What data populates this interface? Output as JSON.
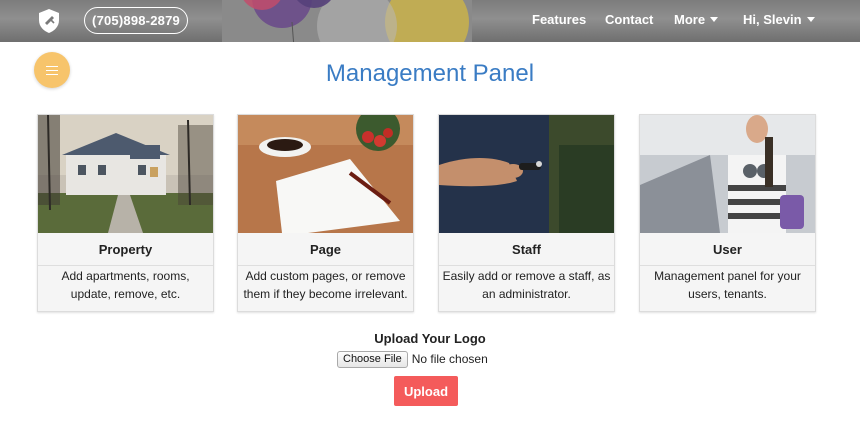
{
  "header": {
    "logo": "shield-logo",
    "phone": "(705)898-2879",
    "nav": {
      "features": "Features",
      "contact": "Contact",
      "more": "More",
      "user": "Hi, Slevin"
    }
  },
  "main": {
    "menu_icon": "hamburger-icon",
    "title": "Management Panel",
    "cards": [
      {
        "title": "Property",
        "description": "Add apartments, rooms, update, remove, etc."
      },
      {
        "title": "Page",
        "description": "Add custom pages, or remove them if they become irrelevant."
      },
      {
        "title": "Staff",
        "description": "Easily add or remove a staff, as an administrator."
      },
      {
        "title": "User",
        "description": "Management panel for your users, tenants."
      }
    ],
    "upload": {
      "label": "Upload Your Logo",
      "choose_button": "Choose File",
      "file_status": "No file chosen",
      "upload_button": "Upload"
    }
  },
  "colors": {
    "title": "#3a7cc4",
    "menu_button": "#f7c46b",
    "upload_button": "#f45b5b",
    "navbar": "#7f7f7f"
  }
}
